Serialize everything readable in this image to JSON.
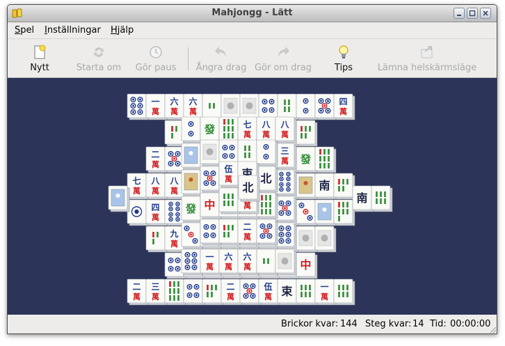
{
  "window": {
    "title": "Mahjongg - Lätt"
  },
  "colors": {
    "board_bg": "#2c3459",
    "tile_face": "#fafaf7",
    "tile_side": "#cfd3d8",
    "red": "#d21d20",
    "blue": "#1f3a8c",
    "green": "#2e8b34"
  },
  "menu": [
    {
      "mnemonic": "S",
      "rest": "pel"
    },
    {
      "mnemonic": "I",
      "rest": "nställningar"
    },
    {
      "mnemonic": "H",
      "rest": "jälp"
    }
  ],
  "toolbar": {
    "new": "Nytt",
    "restart": "Starta om",
    "pause": "Gör paus",
    "undo": "Ångra drag",
    "redo": "Gör om drag",
    "hint": "Tips",
    "leave_fullscreen": "Lämna helskärmsläge"
  },
  "status": {
    "tiles_label": "Brickor kvar:",
    "tiles_value": "144",
    "moves_label": "Steg kvar:",
    "moves_value": "14",
    "time_label": "Tid:",
    "time_value": "00:00:00"
  }
}
